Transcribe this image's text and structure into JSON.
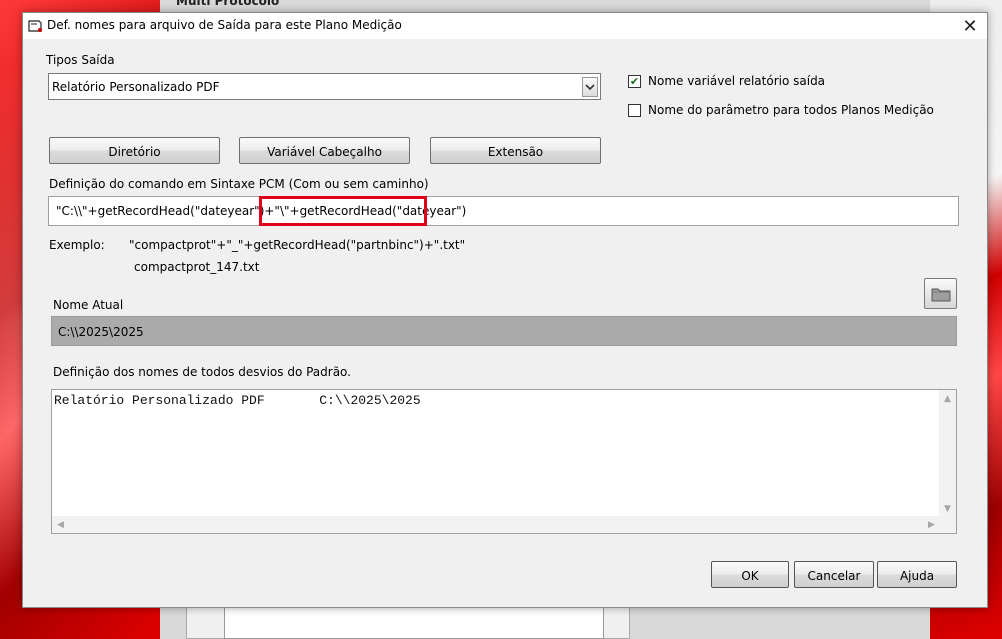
{
  "background": {
    "title": "Multi Protocolo"
  },
  "dialog": {
    "title": "Def. nomes para arquivo de Saída para este Plano Medição",
    "close_glyph": "✕",
    "tipos_saida_label": "Tipos Saída",
    "tipos_saida_value": "Relatório Personalizado PDF",
    "check_nome_variavel": {
      "label": "Nome variável relatório saída",
      "checked": true
    },
    "check_nome_parametro": {
      "label": "Nome do parâmetro para todos Planos Medição",
      "checked": false
    },
    "buttons": {
      "diretorio": "Diretório",
      "variavel_cabecalho": "Variável Cabeçalho",
      "extensao": "Extensão"
    },
    "definicao_label": "Definição do comando em Sintaxe PCM (Com ou sem caminho)",
    "command_value": "\"C:\\\\\"+getRecordHead(\"dateyear\")+\"\\\"+getRecordHead(\"dateyear\")",
    "exemplo_label": "Exemplo:",
    "exemplo_command": "\"compactprot\"+\"_\"+getRecordHead(\"partnbinc\")+\".txt\"",
    "exemplo_result": "compactprot_147.txt",
    "nome_atual_label": "Nome Atual",
    "nome_atual_value": "C:\\\\2025\\2025",
    "desvios_label": "Definição dos nomes de todos desvios do Padrão.",
    "desvios_text": "Relatório Personalizado PDF       C:\\\\2025\\2025",
    "ok": "OK",
    "cancelar": "Cancelar",
    "ajuda": "Ajuda"
  },
  "colors": {
    "highlight": "#e0001a",
    "nome_atual_bg": "#ababab",
    "check_mark": "#1a6e1a"
  },
  "icons": {
    "title": "app-window-icon",
    "folder": "folder-icon",
    "combo_arrow": "chevron-down-icon"
  }
}
